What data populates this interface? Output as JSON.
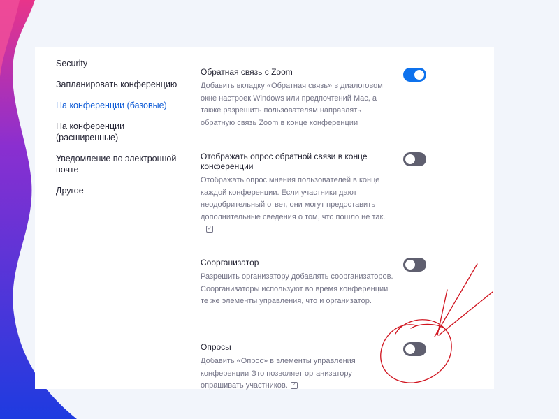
{
  "sidebar": {
    "items": [
      {
        "label": "Security",
        "active": false
      },
      {
        "label": "Запланировать конференцию",
        "active": false
      },
      {
        "label": "На конференции (базовые)",
        "active": true
      },
      {
        "label": "На конференции (расширенные)",
        "active": false
      },
      {
        "label": "Уведомление по электронной почте",
        "active": false
      },
      {
        "label": "Другое",
        "active": false
      }
    ]
  },
  "settings": [
    {
      "title": "Обратная связь с Zoom",
      "description": "Добавить вкладку «Обратная связь» в диалоговом окне настроек Windows или предпочтений Mac, а также разрешить пользователям направлять обратную связь Zoom в конце конференции",
      "enabled": true
    },
    {
      "title": "Отображать опрос обратной связи в конце конференции",
      "description": "Отображать опрос мнения пользователей в конце каждой конференции. Если участники дают неодобрительный ответ, они могут предоставить дополнительные сведения о том, что пошло не так.",
      "enabled": false
    },
    {
      "title": "Соорганизатор",
      "description": "Разрешить организатору добавлять соорганизаторов. Соорганизаторы используют во время конференции те же элементы управления, что и организатор.",
      "enabled": false
    },
    {
      "title": "Опросы",
      "description": "Добавить «Опрос» в элементы управления конференции Это позволяет организатору опрашивать участников.",
      "enabled": false
    }
  ],
  "colors": {
    "accent": "#0e72ed",
    "active_link": "#0e5bd6",
    "toggle_off": "#5f5f6f",
    "annotation": "#d0141f",
    "bg_gradient_start": "#e8348a",
    "bg_gradient_end": "#2a2fd8"
  },
  "icons": {
    "verified": "verified-badge-icon"
  }
}
